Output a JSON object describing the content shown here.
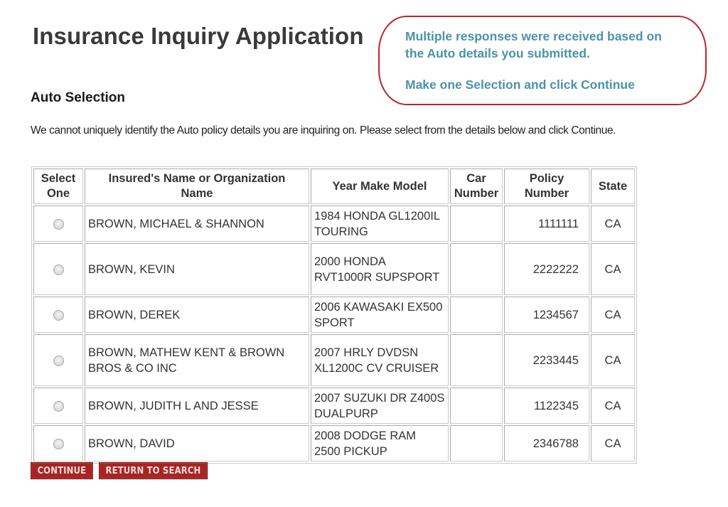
{
  "app": {
    "title": "Insurance Inquiry Application"
  },
  "callout": {
    "line1": "Multiple responses were received based on the Auto details you submitted.",
    "line2": "Make one Selection and click Continue",
    "border_color": "#b5272d",
    "text_color": "#4a93a8"
  },
  "section": {
    "title": "Auto Selection",
    "intro": "We cannot uniquely identify the Auto policy details you are inquiring on.  Please select from the details below and click Continue."
  },
  "table": {
    "headers": {
      "select": "Select One",
      "name": "Insured's Name or Organization Name",
      "ymm": "Year Make Model",
      "car": "Car Number",
      "policy": "Policy Number",
      "state": "State"
    },
    "rows": [
      {
        "name": "BROWN, MICHAEL & SHANNON",
        "ymm": "1984 HONDA GL1200IL TOURING",
        "car": "",
        "policy": "1111111",
        "state": "CA",
        "selected": false
      },
      {
        "name": "BROWN, KEVIN",
        "ymm": "2000 HONDA RVT1000R SUPSPORT",
        "car": "",
        "policy": "2222222",
        "state": "CA",
        "selected": false
      },
      {
        "name": "BROWN, DEREK",
        "ymm": "2006 KAWASAKI EX500 SPORT",
        "car": "",
        "policy": "1234567",
        "state": "CA",
        "selected": false
      },
      {
        "name": "BROWN, MATHEW KENT & BROWN BROS & CO INC",
        "ymm": "2007 HRLY DVDSN XL1200C CV CRUISER",
        "car": "",
        "policy": "2233445",
        "state": "CA",
        "selected": false
      },
      {
        "name": "BROWN, JUDITH L AND JESSE",
        "ymm": "2007 SUZUKI DR Z400S DUALPURP",
        "car": "",
        "policy": "1122345",
        "state": "CA",
        "selected": false
      },
      {
        "name": "BROWN, DAVID",
        "ymm": "2008 DODGE RAM 2500 PICKUP",
        "car": "",
        "policy": "2346788",
        "state": "CA",
        "selected": false
      }
    ]
  },
  "buttons": {
    "continue": "CONTINUE",
    "return": "RETURN TO SEARCH",
    "color": "#a62523"
  }
}
